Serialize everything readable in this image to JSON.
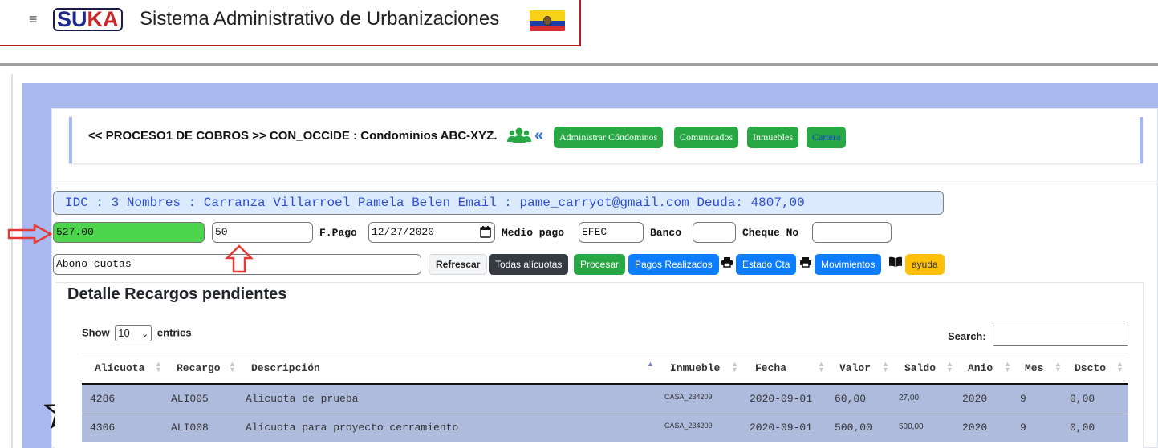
{
  "header": {
    "menu_icon": "hamburger-icon",
    "logo": {
      "s": "S",
      "u": "U",
      "k": "K",
      "a": "A"
    },
    "title": "Sistema Administrativo de Urbanizaciones",
    "flag": "ecuador-flag"
  },
  "process": {
    "text": "<< PROCESO1 DE COBROS >> CON_OCCIDE : Condominios ABC-XYZ.",
    "icons": [
      "users-icon",
      "double-chevron-left-icon"
    ],
    "buttons": [
      "Administrar Cóndominos",
      "Comunicados",
      "Inmuebles",
      "Cartera"
    ]
  },
  "info": {
    "text": "IDC : 3 Nombres : Carranza Villarroel Pamela Belen Email : pame_carryot@gmail.com Deuda: 4807,00"
  },
  "form": {
    "amount_value": "527.00",
    "second_value": "50",
    "fpago_label": "F.Pago",
    "fpago_value": "12/27/2020",
    "medio_label": "Medio pago",
    "medio_value": "EFEC",
    "banco_label": "Banco",
    "banco_value": "",
    "cheque_label": "Cheque No",
    "cheque_value": "",
    "concept_value": "Abono cuotas"
  },
  "actions": {
    "refrescar": "Refrescar",
    "todas": "Todas alícuotas",
    "procesar": "Procesar",
    "pagos": "Pagos Realizados",
    "estado": "Estado Cta",
    "movimientos": "Movimientos",
    "ayuda": "ayuda",
    "icons": [
      "print-icon",
      "print-icon",
      "book-icon"
    ]
  },
  "annotations": [
    "red-arrow-right",
    "red-arrow-up",
    "star-outline"
  ],
  "detail": {
    "title": "Detalle Recargos pendientes",
    "show_label": "Show",
    "length_value": "10",
    "entries_label": "entries",
    "search_label": "Search:",
    "search_value": "",
    "columns": [
      "Alícuota",
      "Recargo",
      "Descripción",
      "Inmueble",
      "Fecha",
      "Valor",
      "Saldo",
      "Anio",
      "Mes",
      "Dscto"
    ],
    "rows": [
      {
        "alicuota": "4286",
        "recargo": "ALI005",
        "descripcion": "Alícuota de prueba",
        "inmueble": "CASA_234209",
        "fecha": "2020-09-01",
        "valor": "60,00",
        "saldo": "27,00",
        "anio": "2020",
        "mes": "9",
        "dscto": "0,00"
      },
      {
        "alicuota": "4306",
        "recargo": "ALI008",
        "descripcion": "Alícuota para proyecto cerramiento",
        "inmueble": "CASA_234209",
        "fecha": "2020-09-01",
        "valor": "500,00",
        "saldo": "500,00",
        "anio": "2020",
        "mes": "9",
        "dscto": "0,00"
      }
    ]
  },
  "colors": {
    "header_border": "#b71c1c",
    "frame": "#a9b9ef",
    "green": "#28a745",
    "amount_field": "#4cd44c",
    "blue": "#0d7cff",
    "dark": "#343a40",
    "yellow": "#ffc107",
    "info_bg": "#dbeafe",
    "info_text": "#2d4ed3",
    "row_bg": "#aebbdd",
    "annotation_red": "#e53935"
  }
}
